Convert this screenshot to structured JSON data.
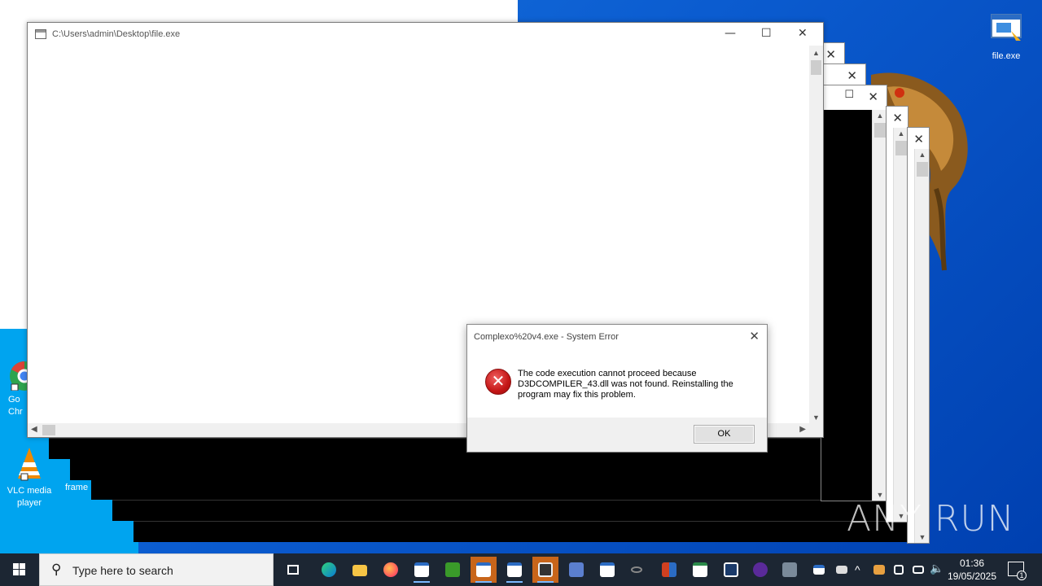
{
  "desktop": {
    "icons": [
      {
        "id": "file-exe",
        "label": "file.exe"
      },
      {
        "id": "chrome",
        "label": "Go\nChr"
      },
      {
        "id": "vlc",
        "label": "VLC media\nplayer"
      },
      {
        "id": "frame",
        "label": "frame"
      }
    ]
  },
  "main_window": {
    "title": "C:\\Users\\admin\\Desktop\\file.exe",
    "minimize": "—",
    "maximize": "☐",
    "close": "✕"
  },
  "background_windows": {
    "close": "✕",
    "maximize": "☐"
  },
  "dialog": {
    "title": "Complexo%20v4.exe - System Error",
    "close": "✕",
    "message": "The code execution cannot proceed because D3DCOMPILER_43.dll was not found. Reinstalling the program may fix this problem.",
    "ok_label": "OK"
  },
  "taskbar": {
    "search_placeholder": "Type here to search",
    "clock_time": "01:36",
    "clock_date": "19/05/2025",
    "notification_count": "1"
  },
  "watermark": "ANY RUN"
}
